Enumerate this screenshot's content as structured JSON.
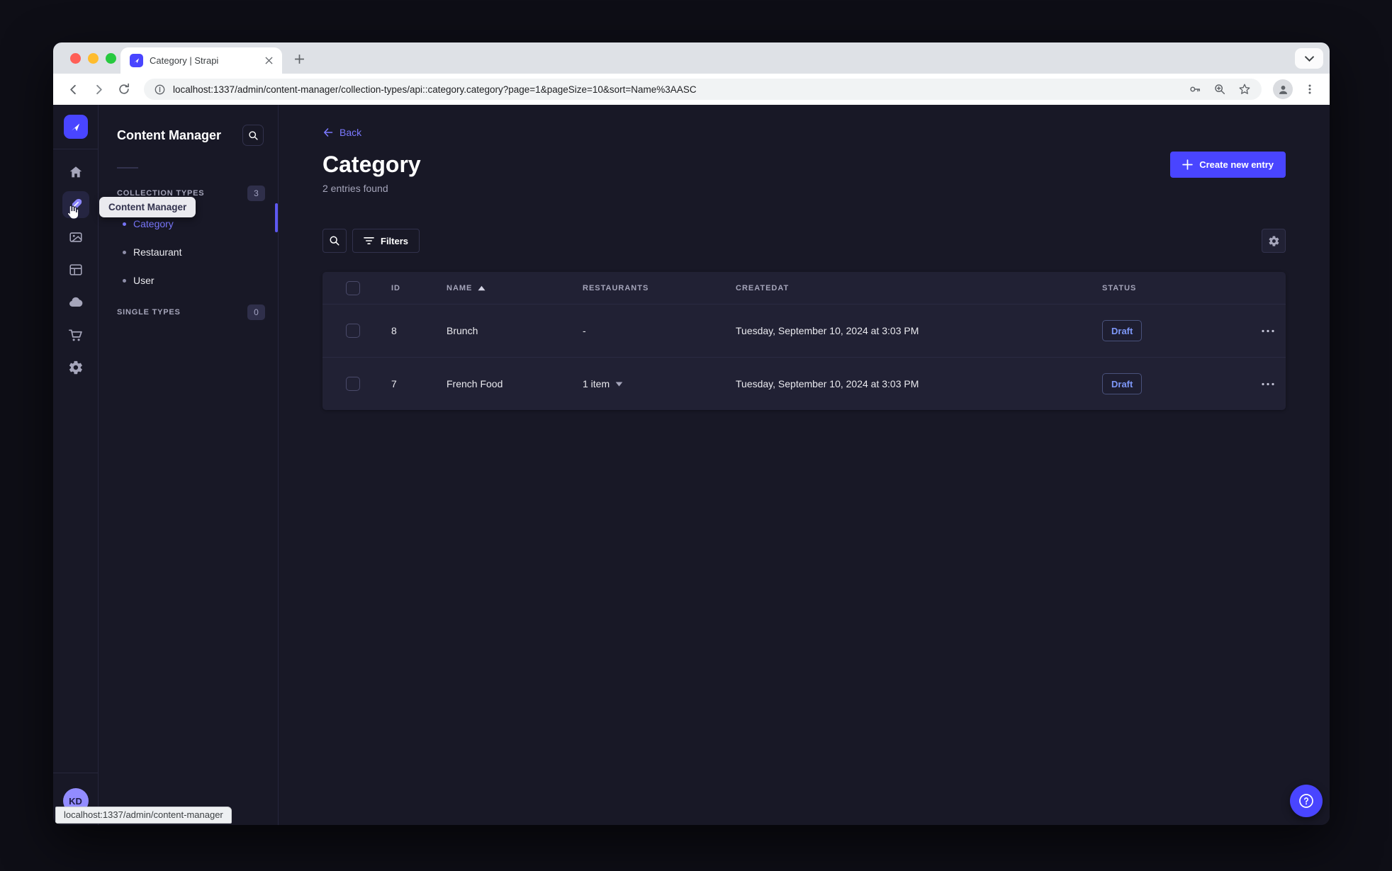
{
  "browser": {
    "tab_title": "Category | Strapi",
    "url": "localhost:1337/admin/content-manager/collection-types/api::category.category?page=1&pageSize=10&sort=Name%3AASC",
    "status_bar": "localhost:1337/admin/content-manager"
  },
  "nav": {
    "tooltip": "Content Manager",
    "user_initials": "KD",
    "icons": [
      "home",
      "content-manager",
      "media-library",
      "content-type-builder",
      "cloud",
      "marketplace",
      "settings"
    ]
  },
  "subnav": {
    "title": "Content Manager",
    "collection_types_label": "COLLECTION TYPES",
    "collection_types_count": "3",
    "items": [
      {
        "label": "Category",
        "active": true
      },
      {
        "label": "Restaurant",
        "active": false
      },
      {
        "label": "User",
        "active": false
      }
    ],
    "single_types_label": "SINGLE TYPES",
    "single_types_count": "0"
  },
  "main": {
    "back_label": "Back",
    "title": "Category",
    "subtitle": "2 entries found",
    "create_button": "Create new entry",
    "filters_button": "Filters",
    "table": {
      "columns": [
        "ID",
        "NAME",
        "RESTAURANTS",
        "CREATEDAT",
        "STATUS"
      ],
      "rows": [
        {
          "id": "8",
          "name": "Brunch",
          "restaurants": "-",
          "created_at": "Tuesday, September 10, 2024 at 3:03 PM",
          "status": "Draft"
        },
        {
          "id": "7",
          "name": "French Food",
          "restaurants": "1 item",
          "created_at": "Tuesday, September 10, 2024 at 3:03 PM",
          "status": "Draft"
        }
      ]
    }
  },
  "colors": {
    "accent": "#4945ff",
    "link": "#7b79ff",
    "draft_text": "#7e98f8",
    "app_bg": "#181826",
    "card_bg": "#212134"
  }
}
